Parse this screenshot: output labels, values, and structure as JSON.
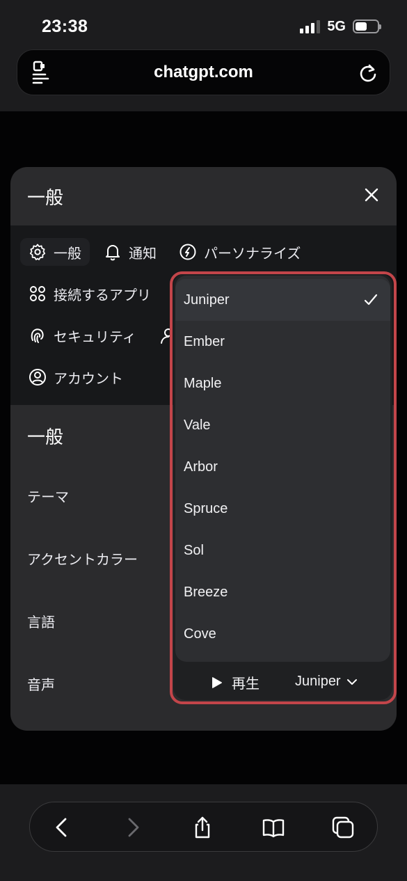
{
  "status_bar": {
    "time": "23:38",
    "network": "5G"
  },
  "browser": {
    "url": "chatgpt.com"
  },
  "modal": {
    "title": "一般",
    "nav": [
      {
        "label": "一般",
        "icon": "gear-icon"
      },
      {
        "label": "通知",
        "icon": "bell-icon"
      },
      {
        "label": "パーソナライズ",
        "icon": "personalize-icon"
      },
      {
        "label": "接続するアプリ",
        "icon": "apps-icon"
      },
      {
        "label": "セキュリティ",
        "icon": "fingerprint-icon"
      },
      {
        "label": "アカウント",
        "icon": "user-circle-icon"
      }
    ],
    "section_title": "一般",
    "settings": [
      "テーマ",
      "アクセントカラー",
      "言語",
      "音声"
    ]
  },
  "voice_dropdown": {
    "options": [
      "Juniper",
      "Ember",
      "Maple",
      "Vale",
      "Arbor",
      "Spruce",
      "Sol",
      "Breeze",
      "Cove"
    ],
    "selected": "Juniper",
    "play_label": "再生",
    "current_voice": "Juniper"
  },
  "colors": {
    "highlight": "#c2454a",
    "modal_bg": "#2b2b2d",
    "page_bg": "#030304"
  }
}
